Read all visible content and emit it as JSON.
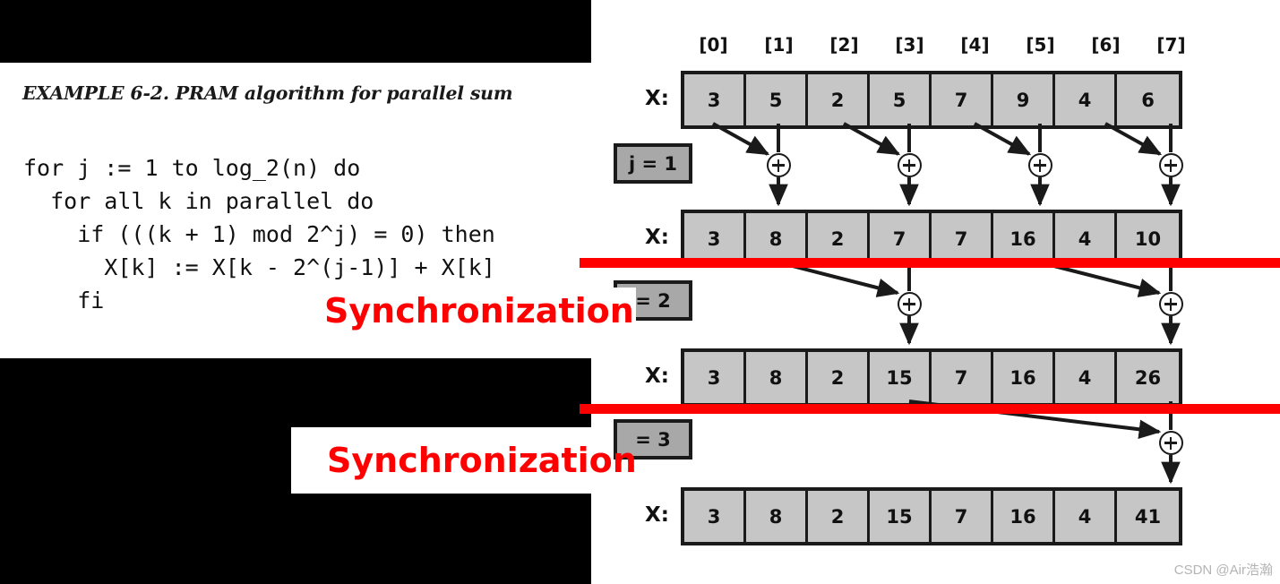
{
  "slide": {
    "example_title": "EXAMPLE 6-2. PRAM algorithm for parallel sum",
    "code": "for j := 1 to log_2(n) do\n  for all k in parallel do\n    if (((k + 1) mod 2^j) = 0) then\n      X[k] := X[k - 2^(j-1)] + X[k]\n    fi",
    "sync_label_1": "Synchronization",
    "sync_label_2": "Synchronization",
    "watermark": "CSDN @Air浩瀚"
  },
  "colors": {
    "red": "#ff0000",
    "cell_fill": "#c6c6c6",
    "jbox_fill": "#a8a8a8",
    "border": "#1a1a1a",
    "black_band": "#000000"
  },
  "chart_data": {
    "type": "diagram",
    "title": "PRAM parallel sum (prefix-style pairwise reduction)",
    "index_labels": [
      "[0]",
      "[1]",
      "[2]",
      "[3]",
      "[4]",
      "[5]",
      "[6]",
      "[7]"
    ],
    "row_label": "X:",
    "steps": [
      {
        "step": 0,
        "j_label": "",
        "values": [
          3,
          5,
          2,
          5,
          7,
          9,
          4,
          6
        ]
      },
      {
        "step": 1,
        "j_label": "j = 1",
        "j_label_visible": "j = 1",
        "values": [
          3,
          8,
          2,
          7,
          7,
          16,
          4,
          10
        ],
        "adds": [
          {
            "from": 0,
            "to": 1
          },
          {
            "from": 2,
            "to": 3
          },
          {
            "from": 4,
            "to": 5
          },
          {
            "from": 6,
            "to": 7
          }
        ]
      },
      {
        "step": 2,
        "j_label": "j = 2",
        "j_label_visible": "= 2",
        "values": [
          3,
          8,
          2,
          15,
          7,
          16,
          4,
          26
        ],
        "adds": [
          {
            "from": 1,
            "to": 3
          },
          {
            "from": 5,
            "to": 7
          }
        ]
      },
      {
        "step": 3,
        "j_label": "j = 3",
        "j_label_visible": "= 3",
        "values": [
          3,
          8,
          2,
          15,
          7,
          16,
          4,
          41
        ],
        "adds": [
          {
            "from": 3,
            "to": 7
          }
        ]
      }
    ],
    "operator_symbol": "+"
  }
}
